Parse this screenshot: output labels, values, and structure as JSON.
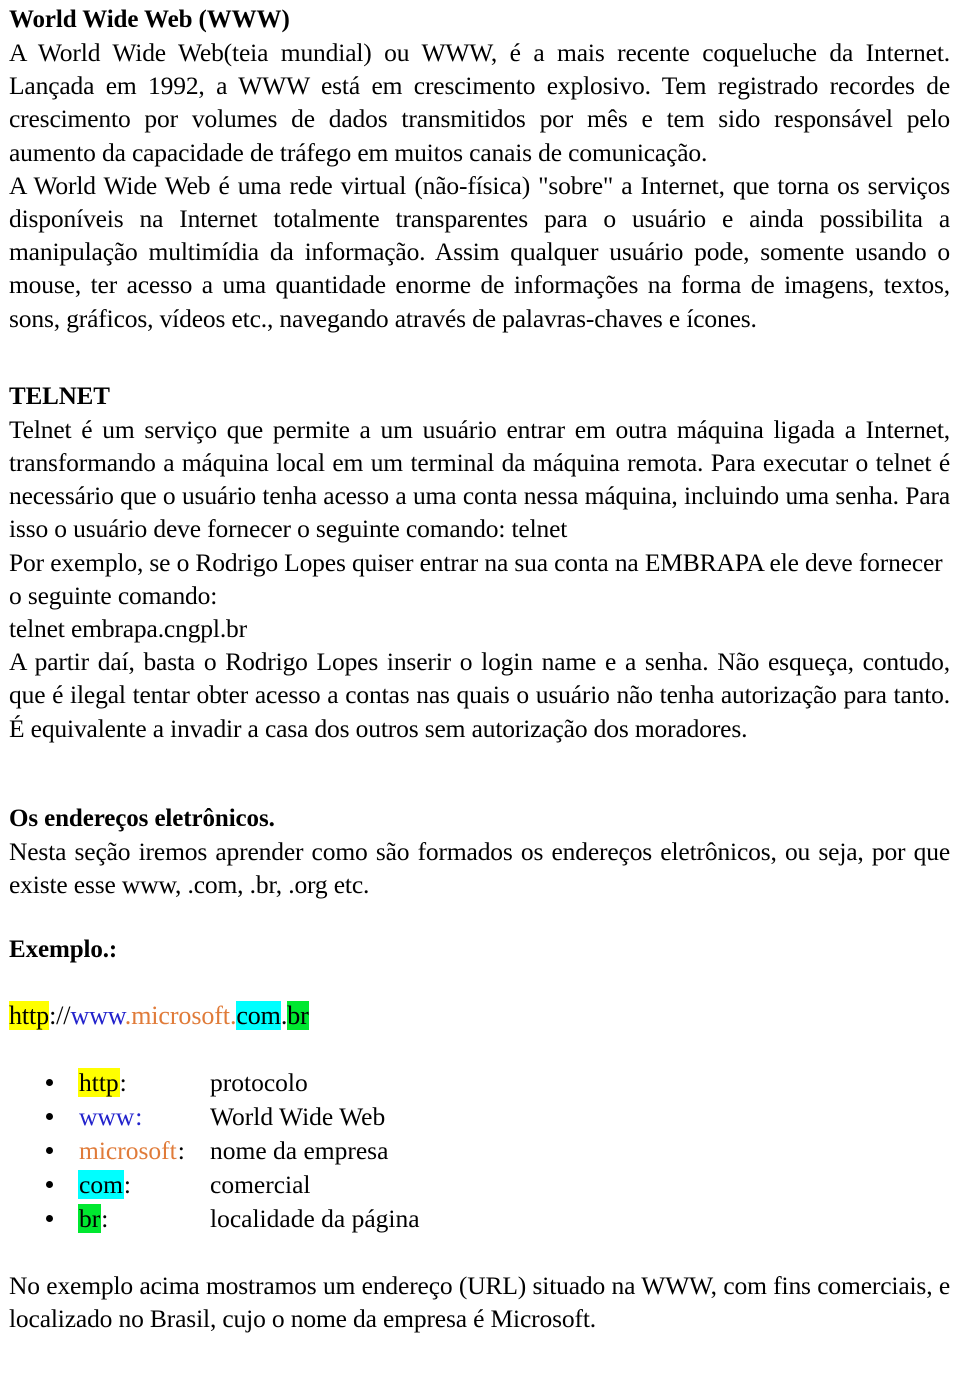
{
  "document": {
    "language": "pt-BR",
    "heading_www": "World Wide Web (WWW)",
    "para_www_1": "A World Wide Web(teia mundial) ou WWW, é a mais recente coqueluche da Internet. Lançada em 1992, a WWW está em crescimento explosivo. Tem registrado recordes de crescimento por volumes de dados transmitidos por mês e tem sido responsável pelo aumento da capacidade de tráfego em muitos canais de comunicação.",
    "para_www_2": "A World Wide Web é uma rede virtual (não-física) \"sobre\" a Internet, que torna os serviços disponíveis na Internet totalmente transparentes para o usuário e ainda possibilita a manipulação multimídia da informação. Assim qualquer usuário pode, somente usando o mouse, ter acesso a uma quantidade enorme de informações na forma de imagens, textos, sons, gráficos, vídeos etc., navegando através de palavras-chaves e ícones.",
    "heading_telnet": "TELNET",
    "para_telnet_1": "Telnet é um serviço que permite a um usuário entrar em outra máquina ligada a Internet, transformando a máquina local em um terminal da máquina remota. Para executar o telnet é necessário que o usuário tenha acesso a uma conta nessa máquina, incluindo uma senha. Para isso o usuário deve fornecer o seguinte comando: telnet",
    "para_telnet_2": "Por exemplo, se o Rodrigo Lopes quiser entrar na sua conta na EMBRAPA ele deve fornecer o seguinte comando:",
    "telnet_command": "telnet embrapa.cngpl.br",
    "para_telnet_3": "A partir daí, basta o Rodrigo Lopes inserir o login name e a senha. Não esqueça, contudo, que é ilegal tentar obter acesso a contas nas quais o usuário não tenha autorização para tanto. É equivalente a invadir a casa dos outros sem autorização dos moradores.",
    "heading_enderecos": "Os endereços eletrônicos.",
    "para_enderecos": "Nesta seção iremos aprender como são formados os endereços eletrônicos, ou seja, por que  existe esse www, .com, .br, .org etc.",
    "heading_exemplo": "Exemplo.:",
    "url_example": {
      "protocol": "http",
      "sep_after_protocol": "://",
      "subdomain": "www",
      "dot1": ".",
      "company": "microsoft",
      "dot2": ".",
      "tld": "com",
      "dot3": ".",
      "country": "br"
    },
    "term_list": [
      {
        "term": "http",
        "colon": ":",
        "definition": "protocolo"
      },
      {
        "term": "www",
        "colon": ":",
        "definition": "World Wide Web"
      },
      {
        "term": "microsoft",
        "colon": ":",
        "definition": "nome da empresa"
      },
      {
        "term": "com",
        "colon": ":",
        "definition": "comercial"
      },
      {
        "term": "br",
        "colon": ":",
        "definition": "localidade da página"
      }
    ],
    "para_final": "No exemplo acima mostramos um endereço (URL) situado na WWW, com fins comerciais, e localizado no Brasil, cujo o nome da empresa é Microsoft."
  },
  "colors": {
    "highlight_yellow": "#ffff00",
    "highlight_cyan": "#00ffff",
    "highlight_green": "#00e830",
    "text_blue": "#2222cc",
    "text_orange": "#e07b39",
    "text_black": "#000000",
    "page_background": "#ffffff"
  }
}
